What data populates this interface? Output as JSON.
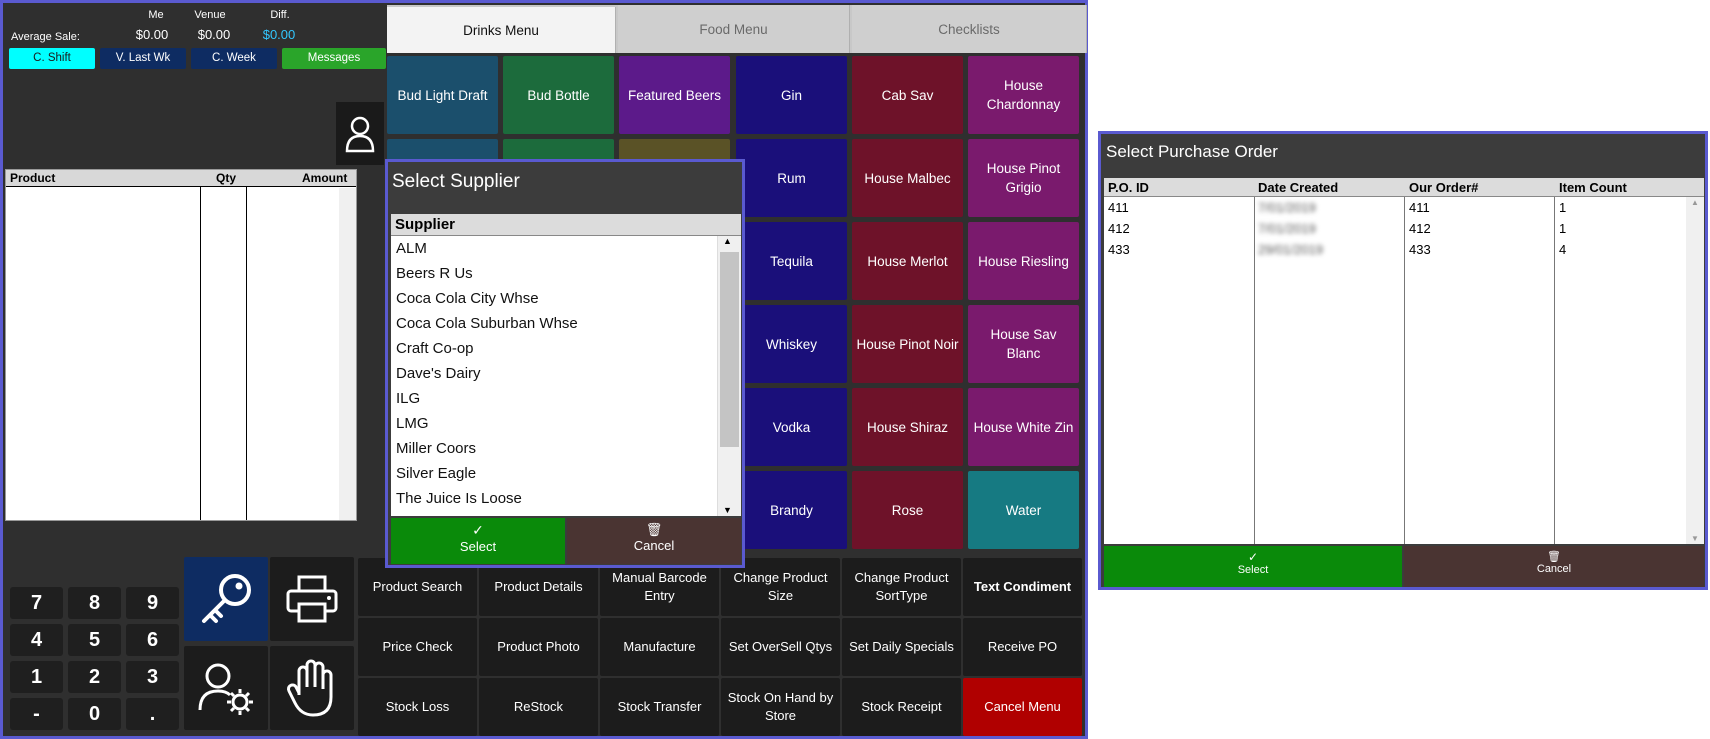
{
  "pos": {
    "stats": {
      "headers": [
        "Me",
        "Venue",
        "Diff."
      ],
      "avg_label": "Average Sale:",
      "values": [
        "$0.00",
        "$0.00",
        "$0.00"
      ]
    },
    "shift_buttons": [
      "C. Shift",
      "V. Last Wk",
      "C. Week",
      "Messages"
    ],
    "order_grid": {
      "columns": [
        "Product",
        "Qty",
        "Amount"
      ]
    },
    "tabs": [
      "Drinks Menu",
      "Food Menu",
      "Checklists"
    ],
    "tiles": [
      "Bud Light Draft",
      "Bud Bottle",
      "Featured Beers",
      "Gin",
      "Cab Sav",
      "House Chardonnay",
      "Rum",
      "House Malbec",
      "House Pinot Grigio",
      "Tequila",
      "House Merlot",
      "House Riesling",
      "Whiskey",
      "House Pinot Noir",
      "House Sav Blanc",
      "Vodka",
      "House Shiraz",
      "House White Zin",
      "Brandy",
      "Rose",
      "Water"
    ],
    "numpad": [
      "7",
      "8",
      "9",
      "4",
      "5",
      "6",
      "1",
      "2",
      "3",
      "-",
      "0",
      "."
    ],
    "functions": [
      "Product Search",
      "Product Details",
      "Manual Barcode Entry",
      "Change Product Size",
      "Change Product SortType",
      "Text Condiment",
      "Price Check",
      "Product Photo",
      "Manufacture",
      "Set OverSell Qtys",
      "Set Daily Specials",
      "Receive PO",
      "Stock Loss",
      "ReStock",
      "Stock Transfer",
      "Stock On Hand by Store",
      "Stock Receipt",
      "Cancel Menu"
    ]
  },
  "supplier_dialog": {
    "title": "Select Supplier",
    "column": "Supplier",
    "items": [
      "ALM",
      "Beers R Us",
      "Coca Cola City Whse",
      "Coca Cola Suburban Whse",
      "Craft Co-op",
      "Dave's Dairy",
      "ILG",
      "LMG",
      "Miller Coors",
      "Silver Eagle",
      "The Juice Is Loose"
    ],
    "select_label": "Select",
    "cancel_label": "Cancel"
  },
  "po_dialog": {
    "title": "Select Purchase Order",
    "columns": [
      "P.O. ID",
      "Date Created",
      "Our Order#",
      "Item Count"
    ],
    "rows": [
      [
        "411",
        "7/01/2019",
        "411",
        "1"
      ],
      [
        "412",
        "7/01/2019",
        "412",
        "1"
      ],
      [
        "433",
        "29/01/2019",
        "433",
        "4"
      ]
    ],
    "select_label": "Select",
    "cancel_label": "Cancel"
  },
  "colors": {
    "selected": "#00ffff",
    "navy_button": "#0e2c62",
    "messages_green": "#2aa52a",
    "select_green": "#0a8a0a",
    "cancel_brown": "#4a3432",
    "cancel_menu_red": "#b00000"
  }
}
